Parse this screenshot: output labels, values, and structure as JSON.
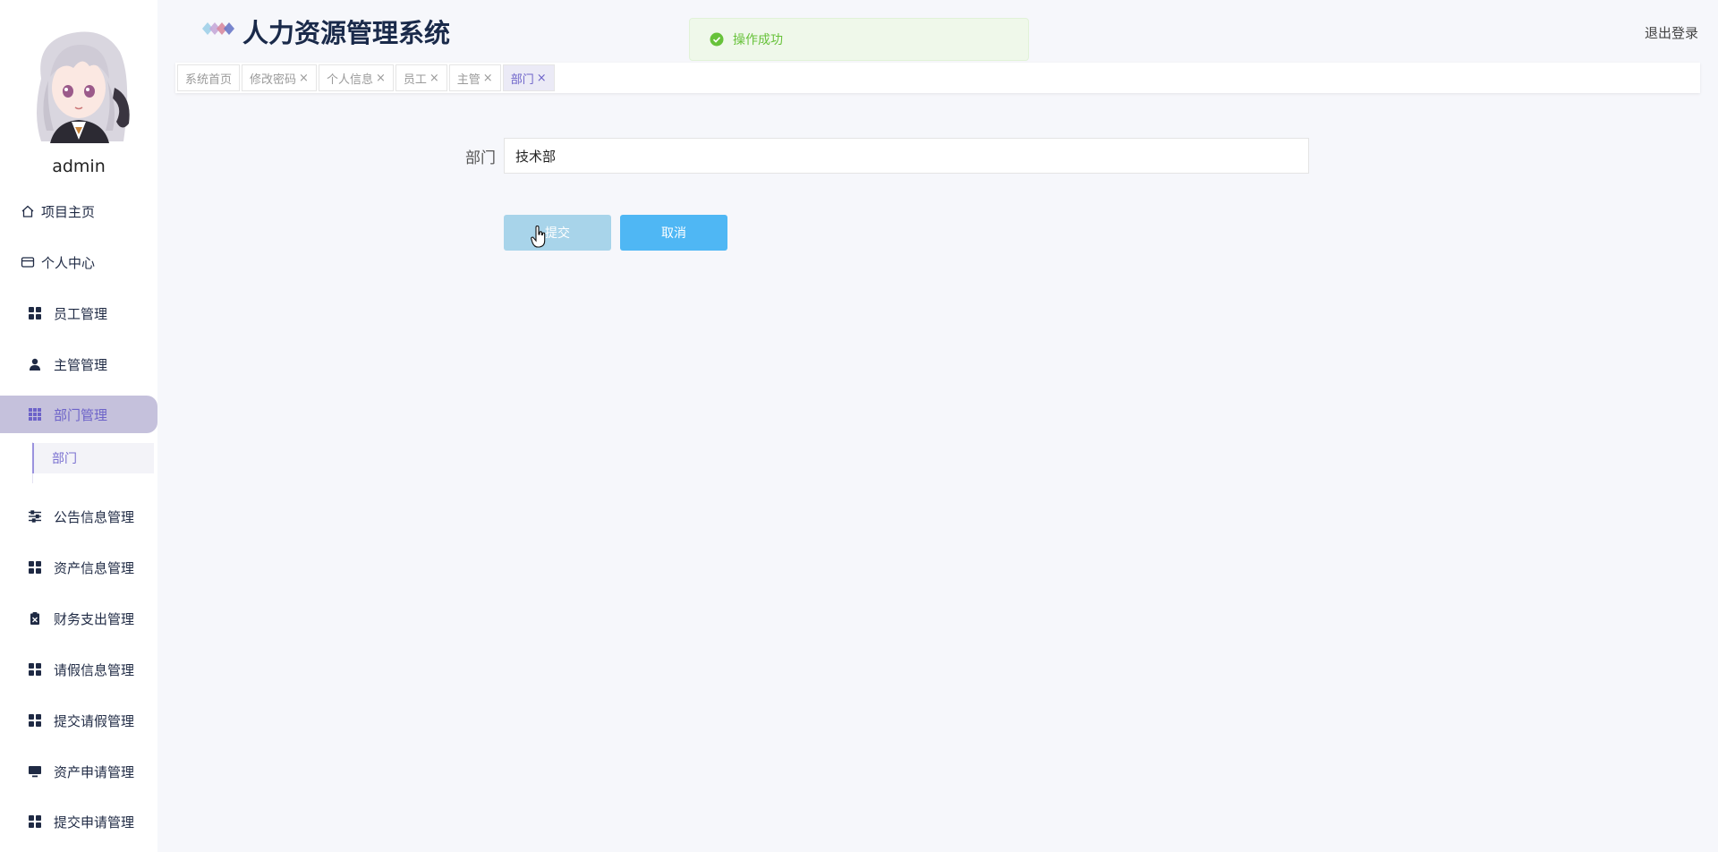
{
  "header": {
    "title": "人力资源管理系统",
    "logout_label": "退出登录"
  },
  "toast": {
    "message": "操作成功"
  },
  "user": {
    "name": "admin"
  },
  "sidebar": {
    "items": [
      {
        "label": "项目主页",
        "icon": "home-icon"
      },
      {
        "label": "个人中心",
        "icon": "card-icon"
      },
      {
        "label": "员工管理",
        "icon": "grid-icon"
      },
      {
        "label": "主管管理",
        "icon": "user-icon"
      },
      {
        "label": "部门管理",
        "icon": "grid9-icon"
      },
      {
        "label": "公告信息管理",
        "icon": "sliders-icon"
      },
      {
        "label": "资产信息管理",
        "icon": "grid-icon"
      },
      {
        "label": "财务支出管理",
        "icon": "clipboard-icon"
      },
      {
        "label": "请假信息管理",
        "icon": "grid-icon"
      },
      {
        "label": "提交请假管理",
        "icon": "grid-icon"
      },
      {
        "label": "资产申请管理",
        "icon": "monitor-icon"
      },
      {
        "label": "提交申请管理",
        "icon": "grid-icon"
      }
    ],
    "active_submenu": {
      "label": "部门"
    }
  },
  "tabs": [
    {
      "label": "系统首页",
      "closable": false
    },
    {
      "label": "修改密码",
      "closable": true
    },
    {
      "label": "个人信息",
      "closable": true
    },
    {
      "label": "员工",
      "closable": true
    },
    {
      "label": "主管",
      "closable": true
    },
    {
      "label": "部门",
      "closable": true,
      "active": true
    }
  ],
  "tab_close_glyph": "×",
  "form": {
    "department_label": "部门",
    "department_value": "技术部",
    "submit_label": "提交",
    "cancel_label": "取消"
  },
  "colors": {
    "accent": "#6d63c9",
    "active_menu_bg": "#c5c1dc",
    "success": "#67c23a",
    "submit": "#a8d4ea",
    "cancel": "#4fb7f4"
  }
}
